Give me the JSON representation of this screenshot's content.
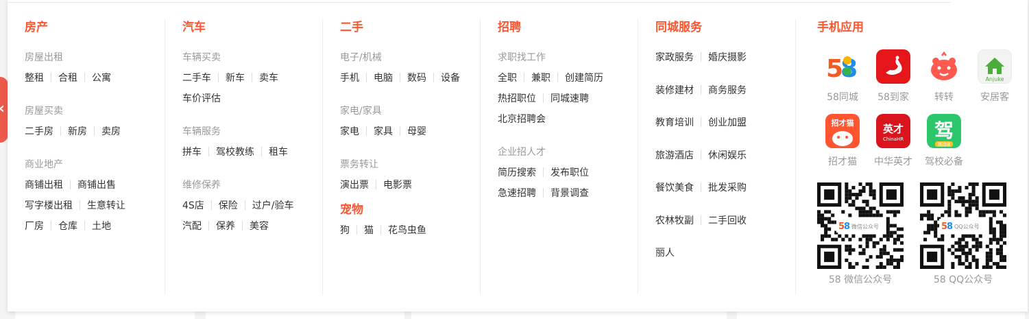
{
  "columns": {
    "house": {
      "title": "房产",
      "groups": [
        {
          "sub": "房屋出租",
          "rows": [
            [
              "整租",
              "合租",
              "公寓"
            ]
          ]
        },
        {
          "sub": "房屋买卖",
          "rows": [
            [
              "二手房",
              "新房",
              "卖房"
            ]
          ]
        },
        {
          "sub": "商业地产",
          "rows": [
            [
              "商铺出租",
              "商铺出售"
            ],
            [
              "写字楼出租",
              "生意转让"
            ],
            [
              "厂房",
              "仓库",
              "土地"
            ]
          ]
        }
      ]
    },
    "car": {
      "title": "汽车",
      "groups": [
        {
          "sub": "车辆买卖",
          "rows": [
            [
              "二手车",
              "新车",
              "卖车"
            ],
            [
              "车价评估"
            ]
          ]
        },
        {
          "sub": "车辆服务",
          "rows": [
            [
              "拼车",
              "驾校教练",
              "租车"
            ]
          ]
        },
        {
          "sub": "维修保养",
          "rows": [
            [
              "4S店",
              "保险",
              "过户/验车"
            ],
            [
              "汽配",
              "保养",
              "美容"
            ]
          ]
        }
      ]
    },
    "used": {
      "title": "二手",
      "groups": [
        {
          "sub": "电子/机械",
          "rows": [
            [
              "手机",
              "电脑",
              "数码",
              "设备"
            ]
          ]
        },
        {
          "sub": "家电/家具",
          "rows": [
            [
              "家电",
              "家具",
              "母婴"
            ]
          ]
        },
        {
          "sub": "票务转让",
          "rows": [
            [
              "演出票",
              "电影票"
            ]
          ]
        }
      ],
      "pets_title": "宠物",
      "pets_rows": [
        [
          "狗",
          "猫",
          "花鸟虫鱼"
        ]
      ]
    },
    "jobs": {
      "title": "招聘",
      "groups": [
        {
          "sub": "求职找工作",
          "rows": [
            [
              "全职",
              "兼职",
              "创建简历"
            ],
            [
              "热招职位",
              "同城速聘"
            ],
            [
              "北京招聘会"
            ]
          ]
        },
        {
          "sub": "企业招人才",
          "rows": [
            [
              "简历搜索",
              "发布职位"
            ],
            [
              "急速招聘",
              "背景调查"
            ]
          ]
        }
      ]
    },
    "services": {
      "title": "同城服务",
      "rows": [
        [
          "家政服务",
          "婚庆摄影"
        ],
        [
          "装修建材",
          "商务服务"
        ],
        [
          "教育培训",
          "创业加盟"
        ],
        [
          "旅游酒店",
          "休闲娱乐"
        ],
        [
          "餐饮美食",
          "批发采购"
        ],
        [
          "农林牧副",
          "二手回收"
        ],
        [
          "丽人"
        ]
      ]
    },
    "apps": {
      "title": "手机应用",
      "items": [
        {
          "label": "58同城",
          "icon": "58-tongcheng-app-icon"
        },
        {
          "label": "58到家",
          "icon": "58-daojia-app-icon"
        },
        {
          "label": "转转",
          "icon": "zhuanzhuan-app-icon"
        },
        {
          "label": "安居客",
          "icon": "anjuke-app-icon"
        },
        {
          "label": "招才猫",
          "icon": "zhaocaimao-app-icon"
        },
        {
          "label": "中华英才",
          "icon": "chinahr-app-icon"
        },
        {
          "label": "驾校必备",
          "icon": "jiaxiao-app-icon"
        }
      ],
      "icon_text": {
        "zhaocaimao": "招才猫",
        "chinahr_cn": "英才",
        "chinahr_en": "ChinaHR",
        "anjuke": "Anjuke",
        "jiaxiao_badge": "微过级",
        "jiaxiao": "驾"
      },
      "qrcodes": [
        {
          "label": "58 微信公众号",
          "badge": "微信公众号"
        },
        {
          "label": "58 QQ公众号",
          "badge": "QQ公众号"
        }
      ]
    }
  },
  "colors": {
    "accent": "#ff552e",
    "muted": "#999999",
    "text": "#333333"
  }
}
